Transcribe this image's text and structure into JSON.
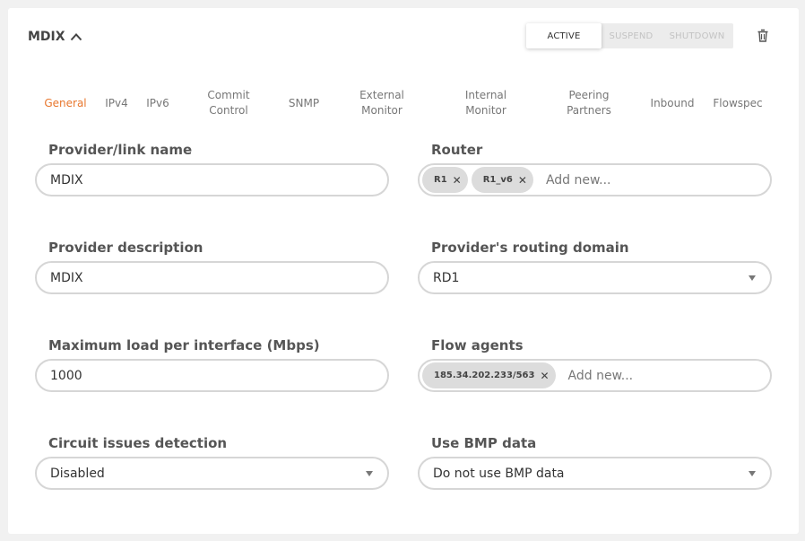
{
  "header": {
    "title": "MDIX",
    "status_buttons": {
      "active": "ACTIVE",
      "suspend": "SUSPEND",
      "shutdown": "SHUTDOWN"
    }
  },
  "tabs": {
    "general": "General",
    "ipv4": "IPv4",
    "ipv6": "IPv6",
    "commit_control": [
      "Commit",
      "Control"
    ],
    "snmp": "SNMP",
    "external_monitor": [
      "External",
      "Monitor"
    ],
    "internal_monitor": [
      "Internal",
      "Monitor"
    ],
    "peering_partners": [
      "Peering",
      "Partners"
    ],
    "inbound": "Inbound",
    "flowspec": "Flowspec"
  },
  "form": {
    "provider_name": {
      "label": "Provider/link name",
      "value": "MDIX"
    },
    "router": {
      "label": "Router",
      "tags": [
        "R1",
        "R1_v6"
      ],
      "placeholder": "Add new..."
    },
    "provider_description": {
      "label": "Provider description",
      "value": "MDIX"
    },
    "routing_domain": {
      "label": "Provider's routing domain",
      "value": "RD1"
    },
    "max_load": {
      "label": "Maximum load per interface (Mbps)",
      "value": "1000"
    },
    "flow_agents": {
      "label": "Flow agents",
      "tags": [
        "185.34.202.233/563"
      ],
      "placeholder": "Add new..."
    },
    "circuit_issues": {
      "label": "Circuit issues detection",
      "value": "Disabled"
    },
    "bmp_data": {
      "label": "Use BMP data",
      "value": "Do not use BMP data"
    }
  },
  "colors": {
    "accent": "#e8772e",
    "border": "#d6d6d6",
    "chip": "#dcdcdc"
  },
  "icons": {
    "collapse": "chevron-up-icon",
    "delete": "trash-icon",
    "remove_tag": "close-icon",
    "dropdown": "caret-down-icon"
  }
}
